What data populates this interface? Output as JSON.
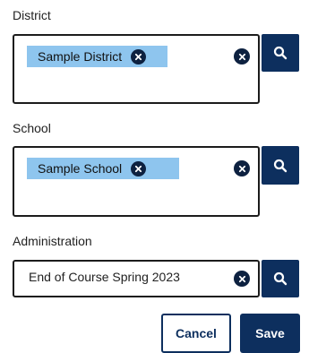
{
  "district": {
    "label": "District",
    "chip": "Sample District"
  },
  "school": {
    "label": "School",
    "chip": "Sample School"
  },
  "administration": {
    "label": "Administration",
    "value": "End of Course Spring 2023"
  },
  "actions": {
    "cancel_label": "Cancel",
    "save_label": "Save"
  },
  "colors": {
    "primary": "#0d2f5e",
    "chip_bg": "#8ec5ee"
  },
  "icons": {
    "clear": "close-circle-icon",
    "search": "search-icon"
  }
}
